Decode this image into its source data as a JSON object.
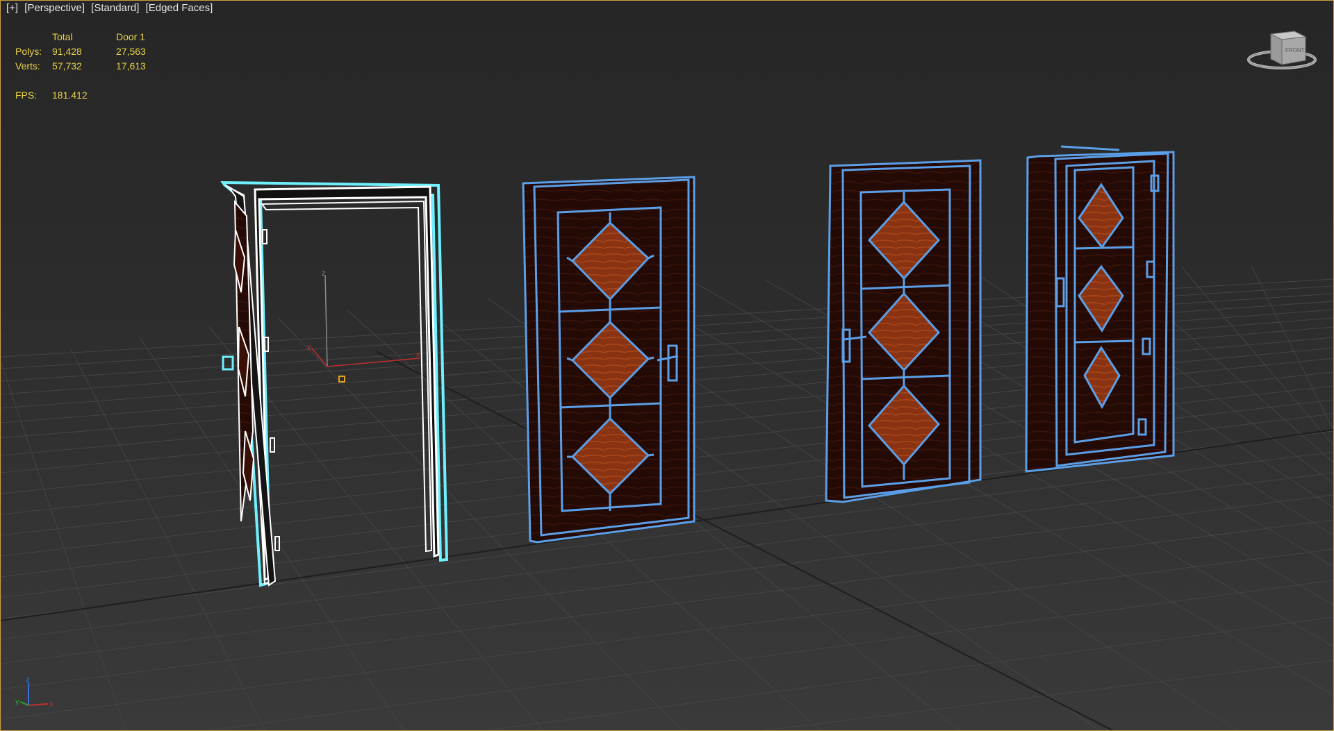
{
  "viewport": {
    "menu": [
      "[+]",
      "[Perspective]",
      "[Standard]",
      "[Edged Faces]"
    ]
  },
  "stats": {
    "header_total": "Total",
    "header_selected": "Door 1",
    "rows": [
      {
        "label": "Polys:",
        "total": "91,428",
        "selected": "27,563"
      },
      {
        "label": "Verts:",
        "total": "57,732",
        "selected": "17,613"
      }
    ],
    "fps_label": "FPS:",
    "fps_value": "181.412"
  },
  "viewcube": {
    "face_label": "FRONT"
  },
  "gizmo": {
    "x": "x",
    "y": "y",
    "z": "z"
  },
  "tripod": {
    "x": "x",
    "y": "y",
    "z": "z"
  },
  "colors": {
    "selection_outline": "#6ff0ff",
    "wire_blue": "#5b9fe8",
    "wood_dark": "#2a0c06",
    "wood_panel": "#8a3312",
    "stats_text": "#e8d24a",
    "grid": "#454545",
    "viewport_border": "#c8a040"
  }
}
